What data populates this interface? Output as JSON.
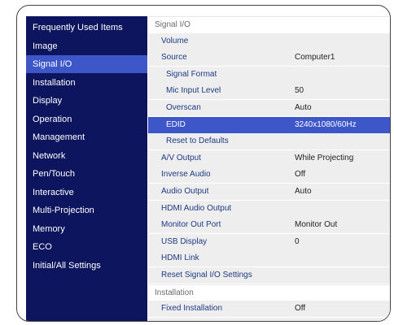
{
  "sidebar": {
    "items": [
      {
        "label": "Frequently Used Items",
        "selected": false
      },
      {
        "label": "Image",
        "selected": false
      },
      {
        "label": "Signal I/O",
        "selected": true
      },
      {
        "label": "Installation",
        "selected": false
      },
      {
        "label": "Display",
        "selected": false
      },
      {
        "label": "Operation",
        "selected": false
      },
      {
        "label": "Management",
        "selected": false
      },
      {
        "label": "Network",
        "selected": false
      },
      {
        "label": "Pen/Touch",
        "selected": false
      },
      {
        "label": "Interactive",
        "selected": false
      },
      {
        "label": "Multi-Projection",
        "selected": false
      },
      {
        "label": "Memory",
        "selected": false
      },
      {
        "label": "ECO",
        "selected": false
      },
      {
        "label": "Initial/All Settings",
        "selected": false
      }
    ]
  },
  "panel": {
    "rows": [
      {
        "type": "header",
        "label": "Signal I/O",
        "value": ""
      },
      {
        "type": "top",
        "label": "Volume",
        "value": ""
      },
      {
        "type": "top",
        "label": "Source",
        "value": "Computer1"
      },
      {
        "type": "sub",
        "label": "Signal Format",
        "value": ""
      },
      {
        "type": "sub",
        "label": "Mic Input Level",
        "value": "50"
      },
      {
        "type": "sub",
        "label": "Overscan",
        "value": "Auto"
      },
      {
        "type": "sub",
        "label": "EDID",
        "value": "3240x1080/60Hz",
        "selected": true
      },
      {
        "type": "sub",
        "label": "Reset to Defaults",
        "value": ""
      },
      {
        "type": "top",
        "label": "A/V Output",
        "value": "While Projecting"
      },
      {
        "type": "top",
        "label": "Inverse Audio",
        "value": "Off"
      },
      {
        "type": "top",
        "label": "Audio Output",
        "value": "Auto"
      },
      {
        "type": "top",
        "label": "HDMI Audio Output",
        "value": ""
      },
      {
        "type": "top",
        "label": "Monitor Out Port",
        "value": "Monitor Out"
      },
      {
        "type": "top",
        "label": "USB Display",
        "value": "0"
      },
      {
        "type": "top",
        "label": "HDMI Link",
        "value": ""
      },
      {
        "type": "top",
        "label": "Reset Signal I/O Settings",
        "value": ""
      },
      {
        "type": "header",
        "label": "Installation",
        "value": ""
      },
      {
        "type": "top",
        "label": "Fixed Installation",
        "value": "Off"
      },
      {
        "type": "top",
        "label": "",
        "value": ""
      }
    ]
  },
  "colors": {
    "sidebar_bg": "#0d155f",
    "selection": "#3d57c8",
    "menu_row_bg": "#eeeeee",
    "label_text": "#1d3a86"
  }
}
